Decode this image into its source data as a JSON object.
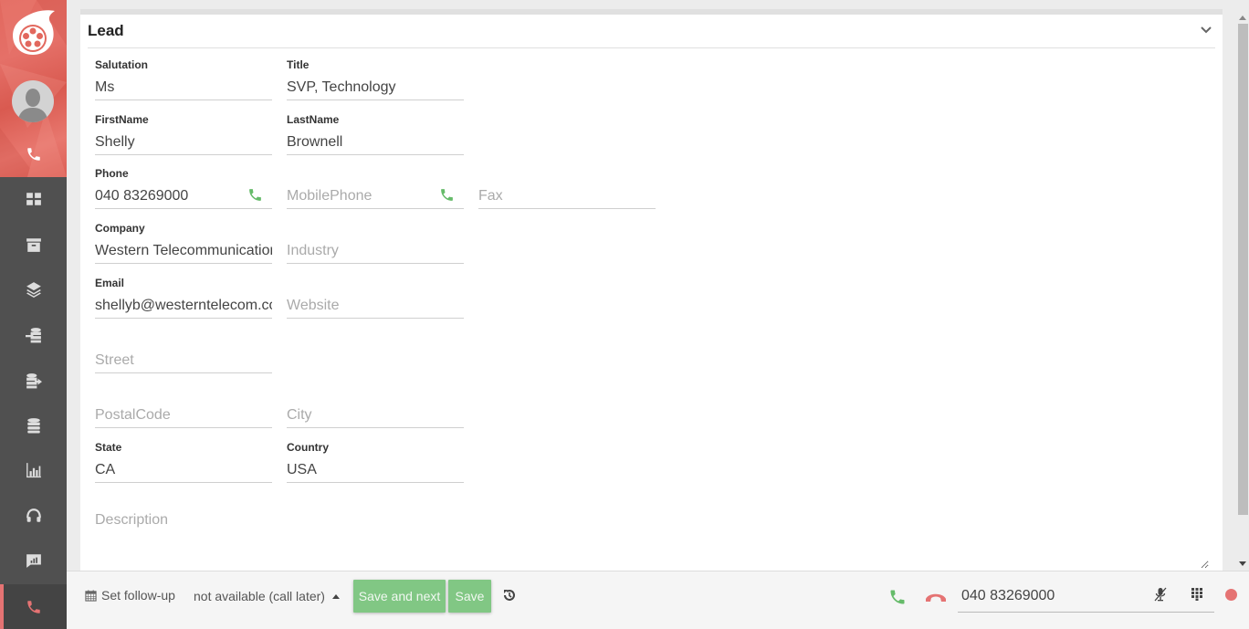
{
  "sidebar": {
    "items": [
      {
        "name": "dashboard",
        "icon": "grid-icon"
      },
      {
        "name": "archive",
        "icon": "archive-box-icon"
      },
      {
        "name": "layers",
        "icon": "layers-icon"
      },
      {
        "name": "import",
        "icon": "database-import-icon"
      },
      {
        "name": "export",
        "icon": "database-export-icon"
      },
      {
        "name": "database",
        "icon": "database-icon"
      },
      {
        "name": "reports",
        "icon": "bar-chart-icon"
      },
      {
        "name": "support",
        "icon": "headphones-icon"
      },
      {
        "name": "feedback",
        "icon": "chat-chart-icon"
      },
      {
        "name": "calls",
        "icon": "phone-icon",
        "active": true
      }
    ],
    "active_color": "#e57373"
  },
  "card": {
    "title": "Lead"
  },
  "fields": {
    "salutation": {
      "label": "Salutation",
      "value": "Ms"
    },
    "title": {
      "label": "Title",
      "value": "SVP, Technology"
    },
    "firstname": {
      "label": "FirstName",
      "value": "Shelly"
    },
    "lastname": {
      "label": "LastName",
      "value": "Brownell"
    },
    "phone": {
      "label": "Phone",
      "value": "040 83269000"
    },
    "mobilephone": {
      "label": "",
      "value": "",
      "placeholder": "MobilePhone"
    },
    "fax": {
      "label": "",
      "value": "",
      "placeholder": "Fax"
    },
    "company": {
      "label": "Company",
      "value": "Western Telecommunications"
    },
    "industry": {
      "label": "",
      "value": "",
      "placeholder": "Industry"
    },
    "email": {
      "label": "Email",
      "value": "shellyb@westerntelecom.com"
    },
    "website": {
      "label": "",
      "value": "",
      "placeholder": "Website"
    },
    "street": {
      "label": "",
      "value": "",
      "placeholder": "Street"
    },
    "postalcode": {
      "label": "",
      "value": "",
      "placeholder": "PostalCode"
    },
    "city": {
      "label": "",
      "value": "",
      "placeholder": "City"
    },
    "state": {
      "label": "State",
      "value": "CA"
    },
    "country": {
      "label": "Country",
      "value": "USA"
    },
    "description": {
      "value": "",
      "placeholder": "Description"
    }
  },
  "footer": {
    "followup_label": "Set follow-up",
    "status_value": "not available (call later)",
    "save_next_label": "Save and next",
    "save_label": "Save",
    "dial_number": "040 83269000"
  },
  "colors": {
    "brand": "#e2685e",
    "button_green": "#81c784",
    "call_green": "#66bb6a",
    "hangup_red": "#e57373"
  }
}
